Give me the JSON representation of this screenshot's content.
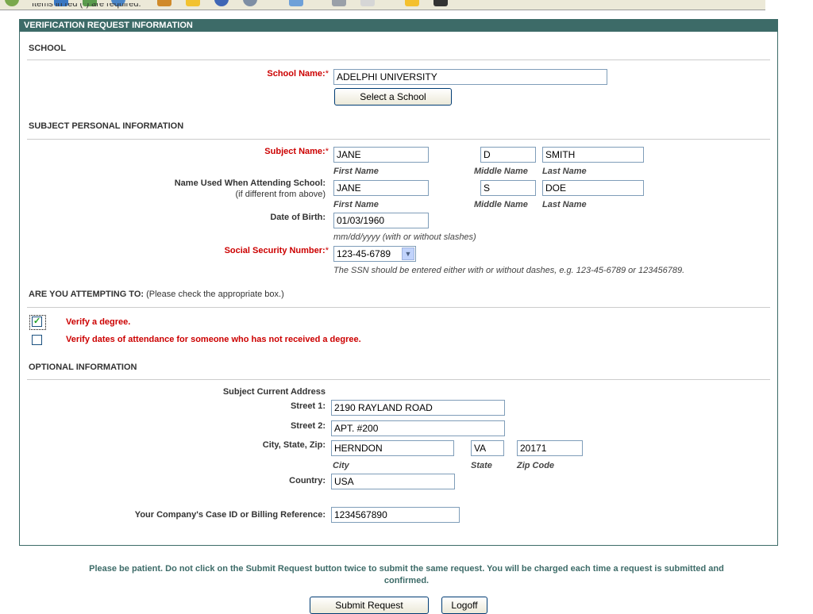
{
  "top": {
    "partial_text": "Items in red (*) are required."
  },
  "banner": "VERIFICATION REQUEST INFORMATION",
  "school": {
    "section": "SCHOOL",
    "label": "School Name:",
    "value": "ADELPHI UNIVERSITY",
    "select_button": "Select a School"
  },
  "subject": {
    "section": "SUBJECT PERSONAL INFORMATION",
    "name_label": "Subject Name:",
    "first": "JANE",
    "middle": "D",
    "last": "SMITH",
    "cap_first": "First Name",
    "cap_middle": "Middle Name",
    "cap_last": "Last Name",
    "alt_label": "Name Used When Attending School:",
    "alt_sub": "(if different from above)",
    "alt_first": "JANE",
    "alt_middle": "S",
    "alt_last": "DOE",
    "dob_label": "Date of Birth:",
    "dob": "01/03/1960",
    "dob_hint": "mm/dd/yyyy (with or without slashes)",
    "ssn_label": "Social Security Number:",
    "ssn": "123-45-6789",
    "ssn_hint": "The SSN should be entered either with or without dashes, e.g. 123-45-6789 or 123456789."
  },
  "attempt": {
    "section": "ARE YOU ATTEMPTING TO:",
    "section_note": "(Please check the appropriate box.)",
    "opt1": "Verify a degree.",
    "opt2": "Verify dates of attendance for someone who has not received a degree."
  },
  "optional": {
    "section": "OPTIONAL INFORMATION",
    "address_label": "Subject Current Address",
    "street1_label": "Street 1:",
    "street1": "2190 RAYLAND ROAD",
    "street2_label": "Street 2:",
    "street2": "APT. #200",
    "csz_label": "City, State, Zip:",
    "city": "HERNDON",
    "state": "VA",
    "zip": "20171",
    "cap_city": "City",
    "cap_state": "State",
    "cap_zip": "Zip Code",
    "country_label": "Country:",
    "country": "USA",
    "case_label": "Your Company's Case ID or Billing Reference:",
    "case": "1234567890"
  },
  "notice_line1": "Please be patient. Do not click on the Submit Request button twice to submit the same request. You will be charged each time a request is submitted and",
  "notice_line2": "confirmed.",
  "buttons": {
    "submit": "Submit Request",
    "logoff": "Logoff"
  }
}
